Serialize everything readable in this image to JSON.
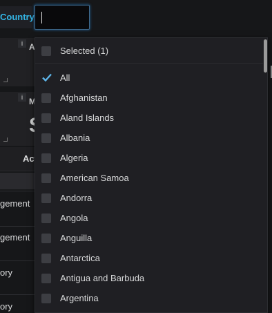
{
  "filter": {
    "label": "Country",
    "input_value": ""
  },
  "background": {
    "panel_a_letter": "A",
    "panel_b_letter": "M",
    "big_value_fragment": "S",
    "info_icon": "i",
    "table_header": "Act",
    "rows": [
      "gement",
      "gement",
      "ory",
      "ory"
    ]
  },
  "dropdown": {
    "selected_header": "Selected (1)",
    "options": [
      {
        "label": "All",
        "checked": true
      },
      {
        "label": "Afghanistan",
        "checked": false
      },
      {
        "label": "Aland Islands",
        "checked": false
      },
      {
        "label": "Albania",
        "checked": false
      },
      {
        "label": "Algeria",
        "checked": false
      },
      {
        "label": "American Samoa",
        "checked": false
      },
      {
        "label": "Andorra",
        "checked": false
      },
      {
        "label": "Angola",
        "checked": false
      },
      {
        "label": "Anguilla",
        "checked": false
      },
      {
        "label": "Antarctica",
        "checked": false
      },
      {
        "label": "Antigua and Barbuda",
        "checked": false
      },
      {
        "label": "Argentina",
        "checked": false
      }
    ]
  },
  "colors": {
    "accent": "#33b5e5",
    "check": "#5db4e8"
  }
}
